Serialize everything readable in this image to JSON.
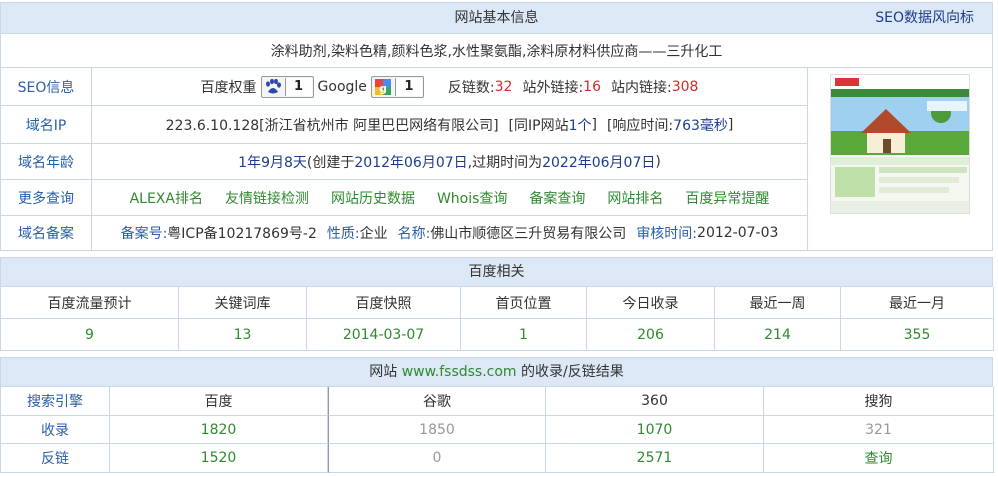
{
  "basic": {
    "title": "网站基本信息",
    "trend_link": "SEO数据风向标",
    "site_title": "涂料助剂,染料色精,颜料色浆,水性聚氨酯,涂料原材料供应商——三升化工"
  },
  "seo": {
    "label": "SEO信息",
    "baidu_weight_label": "百度权重",
    "baidu_weight": "1",
    "google_label": "Google",
    "google_pr": "1",
    "backlinks_label": "反链数:",
    "backlinks": "32",
    "external_label": "站外链接:",
    "external": "16",
    "internal_label": "站内链接:",
    "internal": "308"
  },
  "ip": {
    "label": "域名IP",
    "address": "223.6.10.128[浙江省杭州市 阿里巴巴网络有限公司]",
    "same_ip_prefix": "[同IP网站",
    "same_ip_count": "1个",
    "same_ip_suffix": "]",
    "response_prefix": "[响应时间:",
    "response_value": "763毫秒",
    "response_suffix": "]"
  },
  "age": {
    "label": "域名年龄",
    "age": "1年9月8天",
    "created_prefix": "(创建于",
    "created": "2012年06月07日",
    "expire_prefix": ",过期时间为",
    "expire": "2022年06月07日",
    "end": ")"
  },
  "more": {
    "label": "更多查询",
    "links": [
      "ALEXA排名",
      "友情链接检测",
      "网站历史数据",
      "Whois查询",
      "备案查询",
      "网站排名",
      "百度异常提醒"
    ]
  },
  "icp": {
    "label": "域名备案",
    "no_label": "备案号:",
    "no": "粤ICP备10217869号-2",
    "type_label": "性质:",
    "type": "企业",
    "name_label": "名称:",
    "name": "佛山市顺德区三升贸易有限公司",
    "date_label": "审核时间:",
    "date": "2012-07-03"
  },
  "baidu": {
    "title": "百度相关",
    "headers": [
      "百度流量预计",
      "关键词库",
      "百度快照",
      "首页位置",
      "今日收录",
      "最近一周",
      "最近一月"
    ],
    "values": [
      "9",
      "13",
      "2014-03-07",
      "1",
      "206",
      "214",
      "355"
    ]
  },
  "index": {
    "title_prefix": "网站",
    "domain": "www.fssdss.com",
    "title_suffix": "的收录/反链结果",
    "engine_label": "搜索引擎",
    "engines": [
      "百度",
      "谷歌",
      "360",
      "搜狗"
    ],
    "indexed_label": "收录",
    "indexed": [
      "1820",
      "1850",
      "1070",
      "321"
    ],
    "backlink_label": "反链",
    "backlinks": [
      "1520",
      "0",
      "2571",
      "查询"
    ]
  },
  "colors": {
    "header_bg": "#dce8f5",
    "border": "#c9d8e8",
    "link_green": "#2f8a2f",
    "accent_red": "#d42a2a",
    "label_blue": "#2a5fa8"
  }
}
